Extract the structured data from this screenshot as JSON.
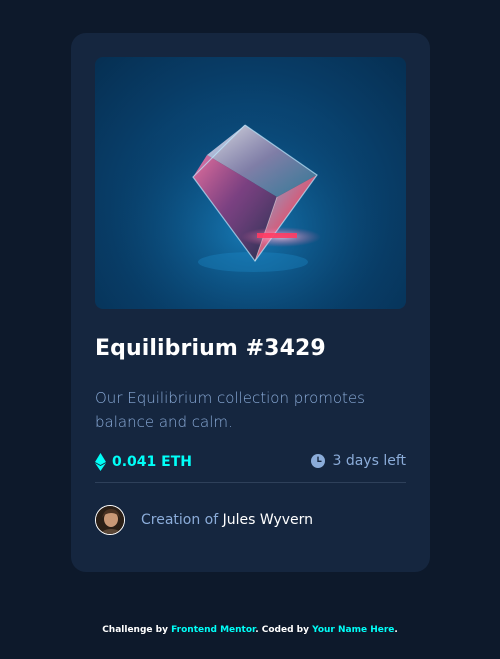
{
  "card": {
    "image_alt": "Equilibrium",
    "title": "Equilibrium #3429",
    "description": "Our Equilibrium collection promotes balance and calm.",
    "price": "0.041 ETH",
    "time_left": "3 days left",
    "creator_prefix": "Creation of",
    "creator_name": "Jules Wyvern"
  },
  "attribution": {
    "challenge_by": "Challenge by",
    "frontend_mentor": "Frontend Mentor",
    "coded_by": ". Coded by",
    "your_name": "Your Name Here",
    "end": "."
  },
  "colors": {
    "background": "#0d192b",
    "card": "#15263f",
    "accent_cyan": "#00fff8",
    "soft_blue": "#8bacd9"
  },
  "icons": {
    "price": "ethereum-icon",
    "time": "clock-icon"
  }
}
